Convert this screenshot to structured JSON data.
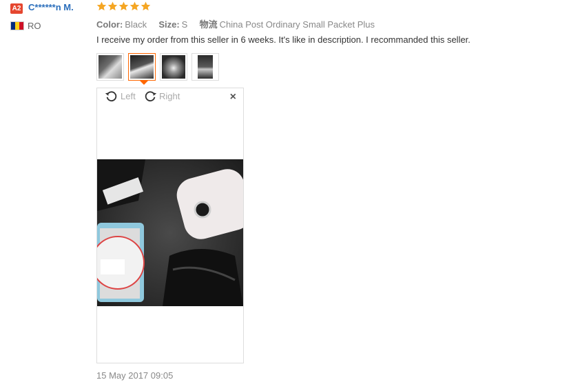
{
  "reviewer": {
    "badge": "A2",
    "name": "C******n M.",
    "country": "RO",
    "flag_colors": [
      "#002b7f",
      "#fcd116",
      "#ce1126"
    ]
  },
  "rating": {
    "stars": 5,
    "max": 5,
    "color": "#f5a623"
  },
  "meta": {
    "color_key": "Color:",
    "color_val": "Black",
    "size_key": "Size:",
    "size_val": "S",
    "shipping_key": "物流",
    "shipping_val": "China Post Ordinary Small Packet Plus"
  },
  "review": {
    "text": "I receive my order from this seller in 6 weeks. It's like in description. I recommanded this seller."
  },
  "thumbnails": [
    {
      "active": false
    },
    {
      "active": true
    },
    {
      "active": false
    },
    {
      "active": false
    }
  ],
  "viewer": {
    "rotate_left": "Left",
    "rotate_right": "Right",
    "close": "×"
  },
  "date": "15 May 2017 09:05"
}
